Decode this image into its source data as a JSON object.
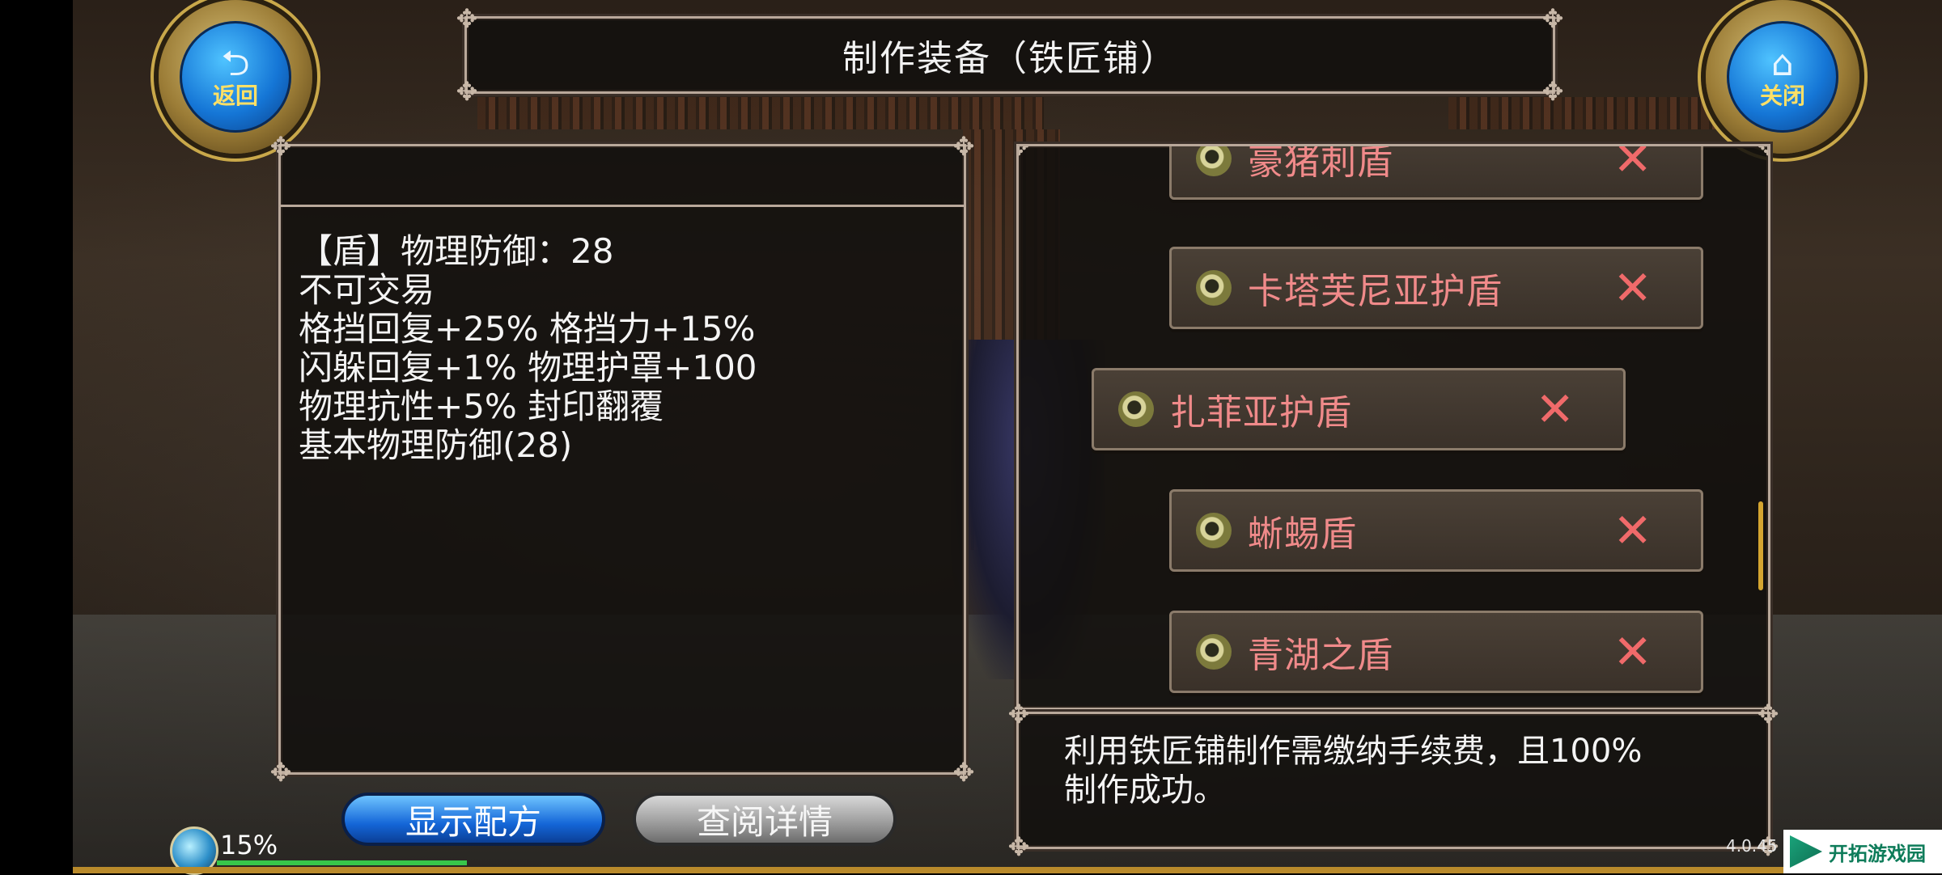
{
  "header": {
    "title": "制作装备（铁匠铺）",
    "back_label": "返回",
    "close_label": "关闭"
  },
  "item_detail": {
    "lines": [
      "【盾】物理防御：28",
      "不可交易",
      "格挡回复+25% 格挡力+15%",
      "闪躲回复+1% 物理护罩+100",
      "物理抗性+5% 封印翻覆",
      "基本物理防御(28)"
    ]
  },
  "recipe_list": {
    "items": [
      {
        "name": "豪猪刺盾",
        "selected": false
      },
      {
        "name": "卡塔芙尼亚护盾",
        "selected": false
      },
      {
        "name": "扎菲亚护盾",
        "selected": true
      },
      {
        "name": "蜥蜴盾",
        "selected": false
      },
      {
        "name": "青湖之盾",
        "selected": false
      }
    ],
    "remove_glyph": "✕"
  },
  "info": {
    "text_line1": "利用铁匠铺制作需缴纳手续费，且100%",
    "text_line2": "制作成功。"
  },
  "buttons": {
    "show_recipe": "显示配方",
    "view_details": "查阅详情"
  },
  "status": {
    "xp_percent_label": "15%",
    "xp_fraction": 0.15,
    "version": "4.0.45"
  },
  "watermark": {
    "text": "开拓游戏园"
  },
  "colors": {
    "item_name": "#f08a8a",
    "remove_x": "#f06a6a",
    "blue_button": "#1466d8",
    "xp_bar": "#39c64a"
  },
  "icons": {
    "back": "back-arrow-icon",
    "close": "home-icon",
    "item": "shield-medallion-icon",
    "remove": "close-x-icon",
    "xp": "xp-orb-icon"
  }
}
